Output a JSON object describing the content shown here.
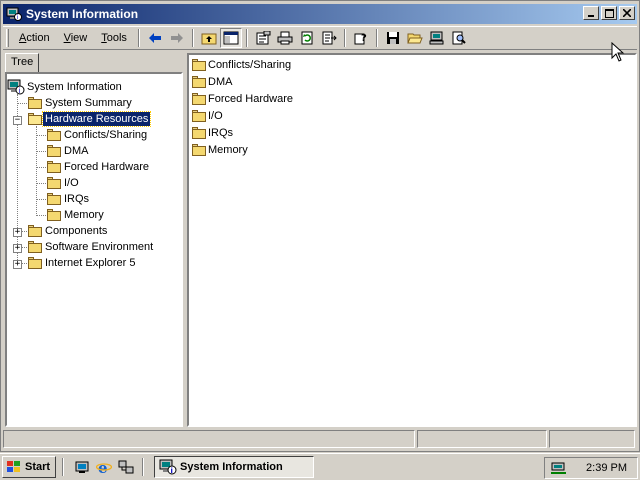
{
  "window": {
    "title": "System Information"
  },
  "menu": [
    {
      "label": "Action",
      "accel": "A",
      "rest": "ction"
    },
    {
      "label": "View",
      "accel": "V",
      "rest": "iew"
    },
    {
      "label": "Tools",
      "accel": "T",
      "rest": "ools"
    }
  ],
  "tabs": {
    "tree_label": "Tree"
  },
  "tree": {
    "root": "System Information",
    "items": [
      {
        "label": "System Summary"
      },
      {
        "label": "Hardware Resources",
        "selected": true,
        "expanded": true
      },
      {
        "label": "Conflicts/Sharing"
      },
      {
        "label": "DMA"
      },
      {
        "label": "Forced Hardware"
      },
      {
        "label": "I/O"
      },
      {
        "label": "IRQs"
      },
      {
        "label": "Memory"
      },
      {
        "label": "Components"
      },
      {
        "label": "Software Environment"
      },
      {
        "label": "Internet Explorer 5"
      }
    ]
  },
  "list": {
    "items": [
      "Conflicts/Sharing",
      "DMA",
      "Forced Hardware",
      "I/O",
      "IRQs",
      "Memory"
    ]
  },
  "taskbar": {
    "start_label": "Start",
    "task_label": "System Information",
    "clock": "2:39 PM"
  },
  "colors": {
    "title_active": "#0a246a",
    "title_gradient_end": "#a6caf0",
    "face": "#d4d0c8",
    "selection": "#0a246a"
  }
}
